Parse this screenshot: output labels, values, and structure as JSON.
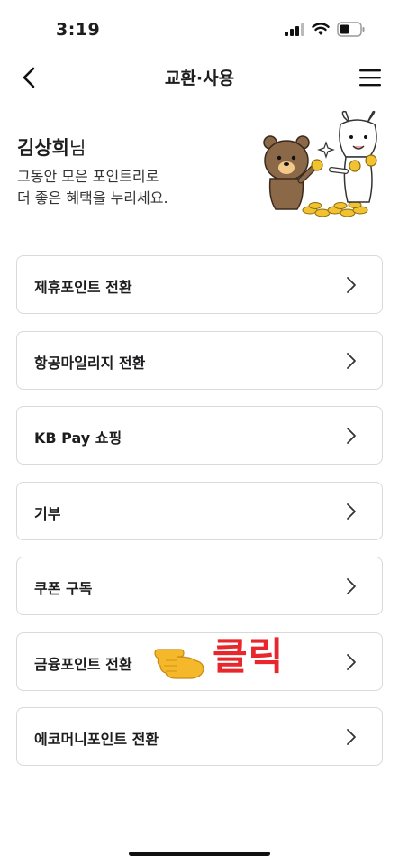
{
  "status_bar": {
    "time": "3:19"
  },
  "header": {
    "title": "교환·사용"
  },
  "greeting": {
    "name": "김상희",
    "suffix": "님",
    "line1": "그동안 모은 포인트리로",
    "line2": "더 좋은 혜택을 누리세요."
  },
  "menu": {
    "items": [
      {
        "label": "제휴포인트 전환"
      },
      {
        "label": "항공마일리지 전환"
      },
      {
        "label": "KB Pay 쇼핑"
      },
      {
        "label": "기부"
      },
      {
        "label": "쿠폰 구독"
      },
      {
        "label": "금융포인트 전환"
      },
      {
        "label": "에코머니포인트 전환"
      }
    ]
  },
  "annotation": {
    "text": "클릭",
    "color": "#e8262b"
  },
  "icons": {
    "back": "chevron-left-icon",
    "menu": "hamburger-menu-icon",
    "item_arrow": "chevron-right-icon",
    "pointer": "pointing-hand-icon"
  }
}
